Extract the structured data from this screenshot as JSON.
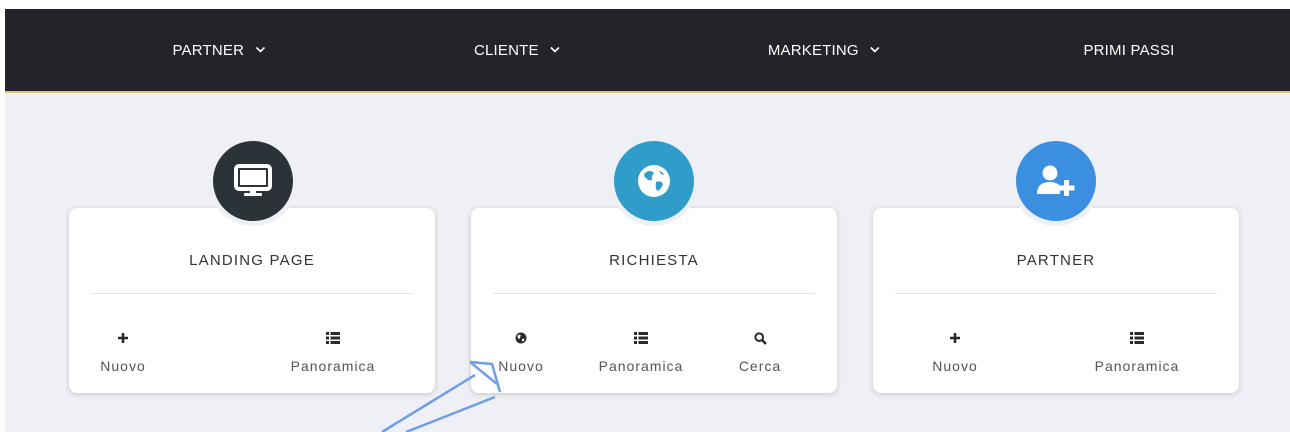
{
  "nav": {
    "items": [
      {
        "label": "PARTNER",
        "has_dropdown": true
      },
      {
        "label": "CLIENTE",
        "has_dropdown": true
      },
      {
        "label": "MARKETING",
        "has_dropdown": true
      },
      {
        "label": "PRIMI PASSI",
        "has_dropdown": false
      }
    ]
  },
  "cards": [
    {
      "title": "LANDING PAGE",
      "icon": "monitor-icon",
      "icon_color": "#2b3238",
      "actions": [
        {
          "label": "Nuovo",
          "icon": "plus-icon"
        },
        {
          "label": "Panoramica",
          "icon": "list-icon"
        }
      ]
    },
    {
      "title": "RICHIESTA",
      "icon": "globe-icon",
      "icon_color": "#2f9cc9",
      "actions": [
        {
          "label": "Nuovo",
          "icon": "globe-icon"
        },
        {
          "label": "Panoramica",
          "icon": "list-icon"
        },
        {
          "label": "Cerca",
          "icon": "search-icon"
        }
      ]
    },
    {
      "title": "PARTNER",
      "icon": "add-user-icon",
      "icon_color": "#3a8fe0",
      "actions": [
        {
          "label": "Nuovo",
          "icon": "plus-icon"
        },
        {
          "label": "Panoramica",
          "icon": "list-icon"
        }
      ]
    }
  ],
  "colors": {
    "nav_background": "#232329",
    "nav_border": "#d9c679",
    "content_background": "#eff0f5",
    "annotation_arrow": "#6f9de8"
  }
}
